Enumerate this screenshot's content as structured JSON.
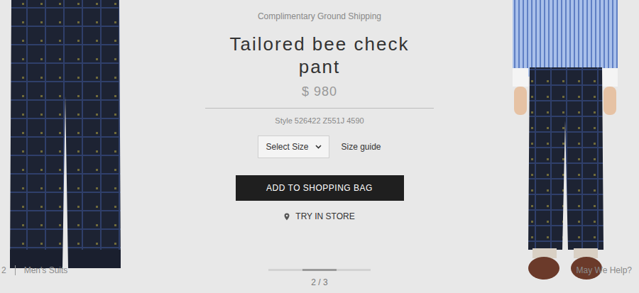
{
  "header": {
    "shipping": "Complimentary Ground Shipping"
  },
  "product": {
    "title": "Tailored bee check pant",
    "price": "$ 980",
    "style": "Style 526422 Z551J 4590"
  },
  "size_select": {
    "value": "Select Size"
  },
  "size_guide": "Size guide",
  "add_button": "ADD TO SHOPPING BAG",
  "try_in_store": "TRY IN STORE",
  "carousel": {
    "slides": [
      {
        "selected": false
      },
      {
        "selected": true
      },
      {
        "selected": false
      }
    ],
    "counter": "2 / 3"
  },
  "breadcrumb": [
    "2",
    "Men's Suits"
  ],
  "help": "May We Help?"
}
